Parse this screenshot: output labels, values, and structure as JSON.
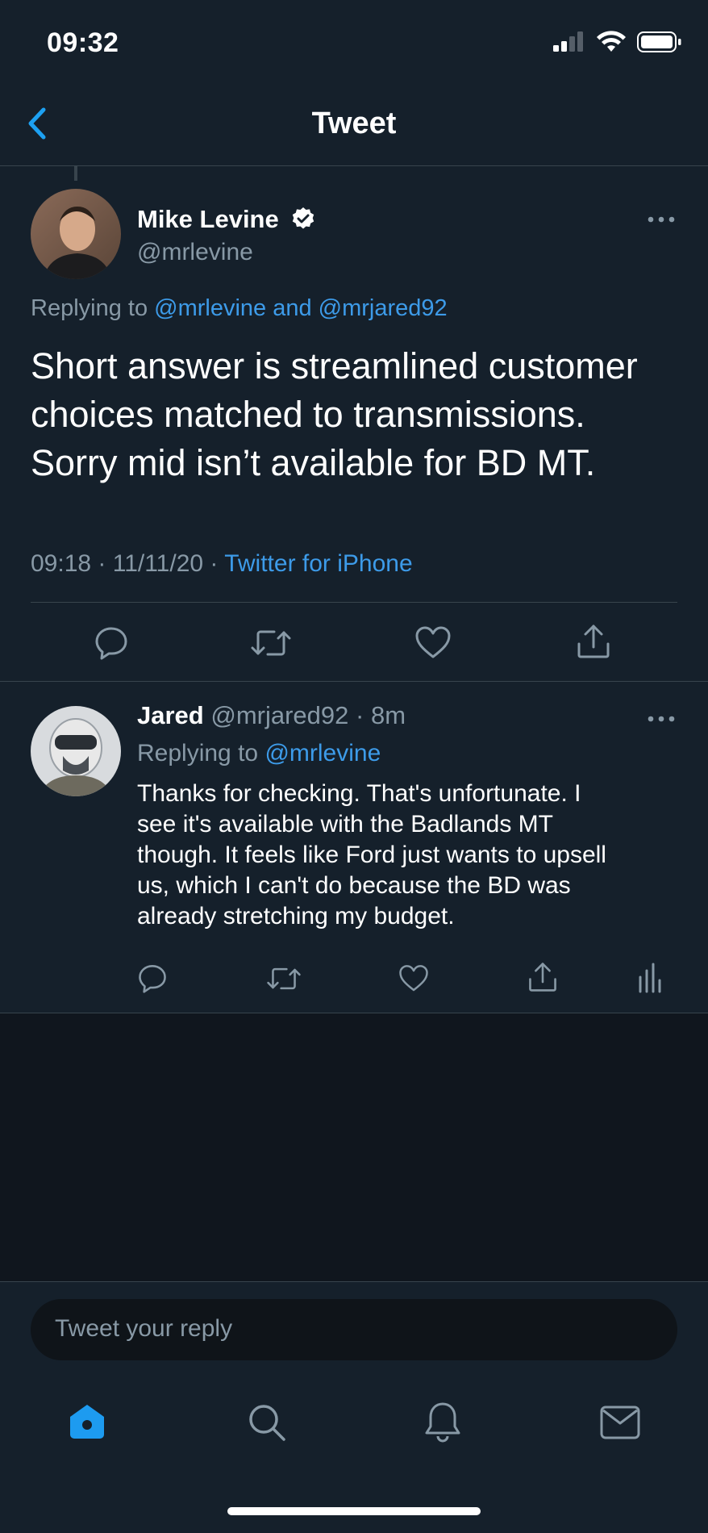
{
  "status_bar": {
    "time": "09:32"
  },
  "nav": {
    "title": "Tweet"
  },
  "main_tweet": {
    "author_name": "Mike Levine",
    "handle": "@mrlevine",
    "replying_prefix": "Replying to",
    "replying_to": "@mrlevine and @mrjared92",
    "text_lines": [
      "Short answer is streamlined customer",
      "choices matched to transmissions.",
      "Sorry mid isn’t available for BD MT."
    ],
    "time": "09:18",
    "date": "11/11/20",
    "source": "Twitter for iPhone"
  },
  "reply": {
    "author_name": "Jared",
    "handle": "@mrjared92",
    "age": "8m",
    "replying_prefix": "Replying to",
    "replying_to": "@mrlevine",
    "text_lines": [
      "Thanks for checking. That's unfortunate. I",
      "see it's available with the Badlands MT",
      "though. It feels like Ford just wants to upsell",
      "us, which I can't do because the BD was",
      "already stretching my budget."
    ]
  },
  "compose": {
    "placeholder": "Tweet your reply"
  },
  "tab_bar": {
    "items": [
      {
        "icon": "home-icon",
        "active": true
      },
      {
        "icon": "search-icon",
        "active": false
      },
      {
        "icon": "bell-icon",
        "active": false
      },
      {
        "icon": "mail-icon",
        "active": false
      }
    ]
  },
  "colors": {
    "background": "#15202b",
    "accent": "#1da1f2",
    "muted": "#8899a6",
    "divider": "#38444d"
  }
}
